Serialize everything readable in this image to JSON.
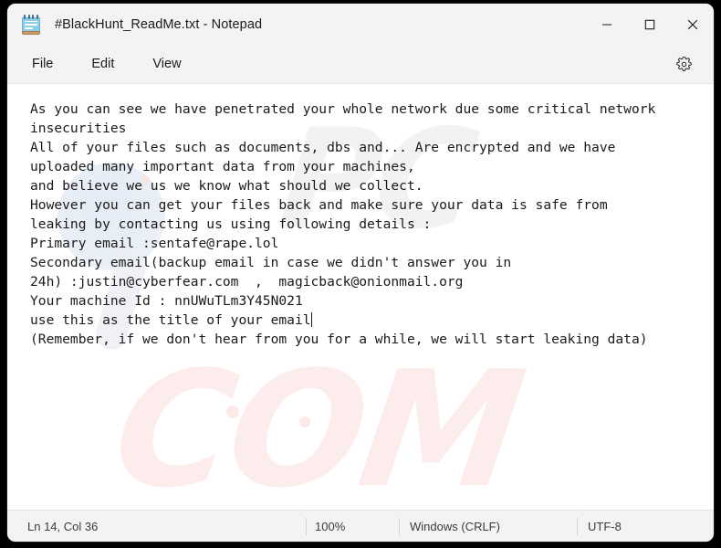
{
  "window": {
    "title": "#BlackHunt_ReadMe.txt - Notepad",
    "app_icon": "notepad-icon",
    "controls": {
      "minimize": "minimize-icon",
      "maximize": "maximize-icon",
      "close": "close-icon"
    }
  },
  "menubar": {
    "items": [
      {
        "label": "File"
      },
      {
        "label": "Edit"
      },
      {
        "label": "View"
      }
    ],
    "settings_icon": "gear-icon"
  },
  "document": {
    "filename": "#BlackHunt_ReadMe.txt",
    "lines": [
      "As you can see we have penetrated your whole network due some critical network",
      "insecurities",
      "All of your files such as documents, dbs and... Are encrypted and we have",
      "uploaded many important data from your machines,",
      "and believe we us we know what should we collect.",
      "",
      "",
      "However you can get your files back and make sure your data is safe from",
      "leaking by contacting us using following details :",
      "",
      "",
      "Primary email :sentafe@rape.lol",
      "",
      "Secondary email(backup email in case we didn't answer you in",
      "24h) :justin@cyberfear.com  ,  magicback@onionmail.org",
      "",
      "Your machine Id : nnUWuTLm3Y45N021",
      "use this as the title of your email",
      "",
      "",
      "(Remember, if we don't hear from you for a while, we will start leaking data)"
    ],
    "caret_after_line_index": 17,
    "emails": {
      "primary": "sentafe@rape.lol",
      "secondary_1": "justin@cyberfear.com",
      "secondary_2": "magicback@onionmail.org"
    },
    "machine_id": "nnUWuTLm3Y45N021"
  },
  "statusbar": {
    "cursor": "Ln 14, Col 36",
    "zoom": "100%",
    "line_endings": "Windows (CRLF)",
    "encoding": "UTF-8"
  },
  "colors": {
    "chrome": "#f3f3f3",
    "editor_bg": "#ffffff",
    "text": "#1a1a1a",
    "close_hover": "#c42b1c",
    "icon_blue": "#8fcce6"
  },
  "watermark": {
    "word_1": "PC",
    "word_2": "COM"
  }
}
